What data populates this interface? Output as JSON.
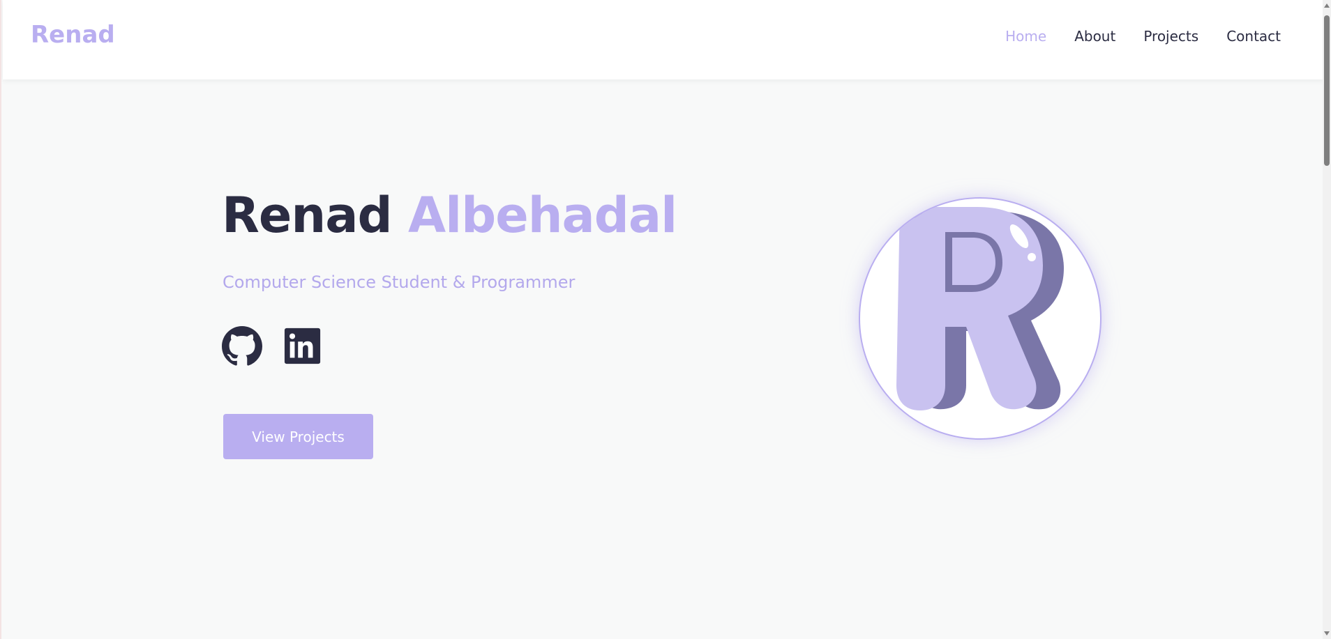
{
  "navbar": {
    "logo": "Renad",
    "links": [
      {
        "label": "Home",
        "active": true
      },
      {
        "label": "About",
        "active": false
      },
      {
        "label": "Projects",
        "active": false
      },
      {
        "label": "Contact",
        "active": false
      }
    ]
  },
  "hero": {
    "first_name": "Renad",
    "last_name": "Albehadal",
    "subtitle": "Computer Science Student & Programmer",
    "socials": [
      {
        "icon": "github-icon"
      },
      {
        "icon": "linkedin-icon"
      }
    ],
    "cta_label": "View Projects",
    "avatar_letter_icon": "letter-r-avatar"
  },
  "colors": {
    "accent": "#b9aef0",
    "dark": "#2b2c42",
    "background": "#f8f9f9",
    "avatar_shadow_letter": "#7a76a8",
    "avatar_letter": "#c9c2f0"
  }
}
